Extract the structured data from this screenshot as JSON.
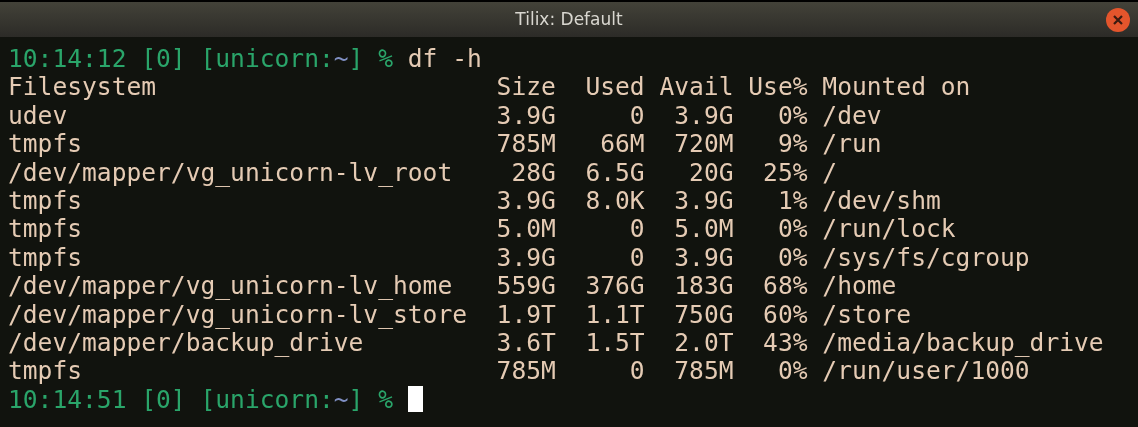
{
  "window": {
    "title": "Tilix: Default"
  },
  "lines": [
    {
      "kind": "prompt",
      "time": "10:14:12",
      "status": "[0]",
      "host": "[unicorn:",
      "cwd": "~",
      "close": "]",
      "symbol": "%",
      "command": "df -h",
      "cursor": false
    },
    {
      "kind": "header",
      "cells": [
        "Filesystem",
        "Size",
        "Used",
        "Avail",
        "Use%",
        "Mounted on"
      ]
    },
    {
      "kind": "row",
      "cells": [
        "udev",
        "3.9G",
        "0",
        "3.9G",
        "0%",
        "/dev"
      ]
    },
    {
      "kind": "row",
      "cells": [
        "tmpfs",
        "785M",
        "66M",
        "720M",
        "9%",
        "/run"
      ]
    },
    {
      "kind": "row",
      "cells": [
        "/dev/mapper/vg_unicorn-lv_root",
        "28G",
        "6.5G",
        "20G",
        "25%",
        "/"
      ]
    },
    {
      "kind": "row",
      "cells": [
        "tmpfs",
        "3.9G",
        "8.0K",
        "3.9G",
        "1%",
        "/dev/shm"
      ]
    },
    {
      "kind": "row",
      "cells": [
        "tmpfs",
        "5.0M",
        "0",
        "5.0M",
        "0%",
        "/run/lock"
      ]
    },
    {
      "kind": "row",
      "cells": [
        "tmpfs",
        "3.9G",
        "0",
        "3.9G",
        "0%",
        "/sys/fs/cgroup"
      ]
    },
    {
      "kind": "row",
      "cells": [
        "/dev/mapper/vg_unicorn-lv_home",
        "559G",
        "376G",
        "183G",
        "68%",
        "/home"
      ]
    },
    {
      "kind": "row",
      "cells": [
        "/dev/mapper/vg_unicorn-lv_store",
        "1.9T",
        "1.1T",
        "750G",
        "60%",
        "/store"
      ]
    },
    {
      "kind": "row",
      "cells": [
        "/dev/mapper/backup_drive",
        "3.6T",
        "1.5T",
        "2.0T",
        "43%",
        "/media/backup_drive"
      ]
    },
    {
      "kind": "row",
      "cells": [
        "tmpfs",
        "785M",
        "0",
        "785M",
        "0%",
        "/run/user/1000"
      ]
    },
    {
      "kind": "prompt",
      "time": "10:14:51",
      "status": "[0]",
      "host": "[unicorn:",
      "cwd": "~",
      "close": "]",
      "symbol": "%",
      "cursor": true
    }
  ]
}
